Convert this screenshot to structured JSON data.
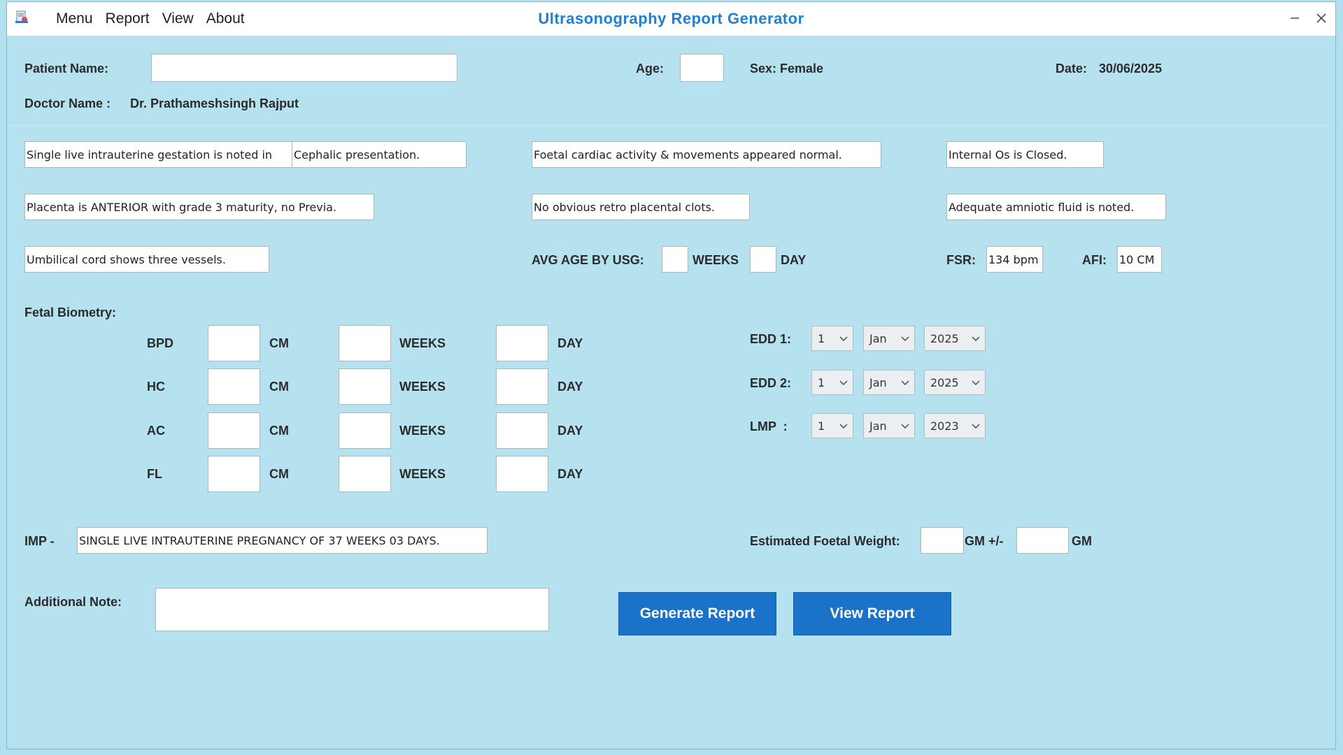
{
  "menu": {
    "items": [
      "Menu",
      "Report",
      "View",
      "About"
    ]
  },
  "title": "Ultrasonography Report Generator",
  "header": {
    "patient_name_label": "Patient Name:",
    "patient_name_value": "",
    "age_label": "Age:",
    "age_value": "",
    "sex_text": "Sex: Female",
    "date_label": "Date:",
    "date_value": "30/06/2025",
    "doctor_label": "Doctor Name :",
    "doctor_value": "Dr. Prathameshsingh Rajput"
  },
  "findings": {
    "gestation_prefix": "Single live intrauterine gestation is noted in",
    "presentation": "Cephalic presentation.",
    "cardiac": "Foetal cardiac activity & movements appeared normal.",
    "internal_os": "Internal Os is Closed.",
    "placenta": "Placenta is ANTERIOR with grade 3 maturity, no Previa.",
    "clots": "No obvious retro placental clots.",
    "amniotic": "Adequate amniotic fluid is noted.",
    "cord": "Umbilical cord shows three vessels."
  },
  "usg": {
    "avg_age_label": "AVG AGE BY USG:",
    "weeks_label": "WEEKS",
    "day_label": "DAY",
    "weeks_value": "",
    "day_value": "",
    "fsr_label": "FSR:",
    "fsr_value": "134 bpm",
    "afi_label": "AFI:",
    "afi_value": "10 CM"
  },
  "biometry": {
    "title": "Fetal Biometry:",
    "cm_label": "CM",
    "weeks_label": "WEEKS",
    "day_label": "DAY",
    "rows": [
      {
        "label": "BPD",
        "cm": "",
        "weeks": "",
        "day": ""
      },
      {
        "label": "HC",
        "cm": "",
        "weeks": "",
        "day": ""
      },
      {
        "label": "AC",
        "cm": "",
        "weeks": "",
        "day": ""
      },
      {
        "label": "FL",
        "cm": "",
        "weeks": "",
        "day": ""
      }
    ]
  },
  "dates": [
    {
      "label": "EDD 1:",
      "day": "1",
      "month": "Jan",
      "year": "2025"
    },
    {
      "label": "EDD 2:",
      "day": "1",
      "month": "Jan",
      "year": "2025"
    },
    {
      "label": "LMP  :",
      "day": "1",
      "month": "Jan",
      "year": "2023"
    }
  ],
  "imp": {
    "label": "IMP -",
    "value": "SINGLE LIVE INTRAUTERINE PREGNANCY OF 37 WEEKS 03 DAYS."
  },
  "efw": {
    "label": "Estimated Foetal Weight:",
    "gm_pm_label": "GM +/-",
    "gm_label": "GM",
    "value": "",
    "variance": ""
  },
  "note": {
    "label": "Additional Note:",
    "value": ""
  },
  "buttons": {
    "generate": "Generate Report",
    "view": "View Report"
  },
  "colors": {
    "background": "#b6e2ef",
    "title": "#1f7fd0",
    "button": "#1a73c9"
  },
  "icons": {
    "app": "document-scan-icon",
    "minimize": "minimize-icon",
    "close": "close-icon",
    "dropdown": "chevron-down-icon"
  }
}
